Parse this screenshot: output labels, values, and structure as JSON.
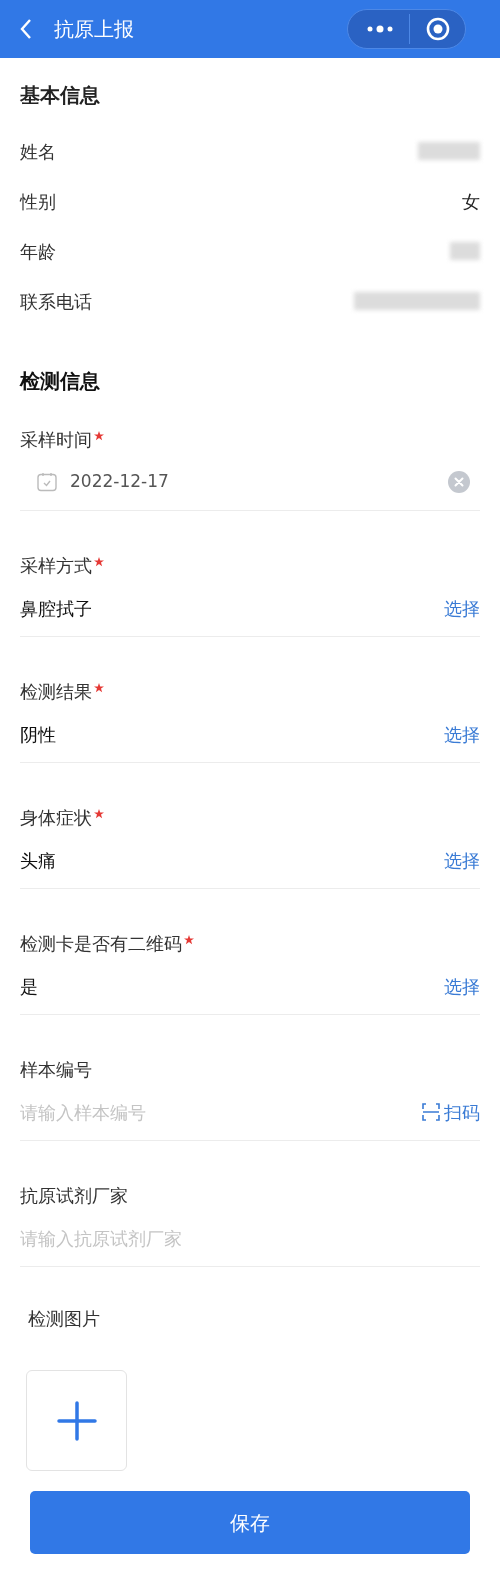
{
  "header": {
    "title": "抗原上报"
  },
  "basic": {
    "title": "基本信息",
    "rows": [
      {
        "label": "姓名",
        "kind": "redacted"
      },
      {
        "label": "性别",
        "kind": "text",
        "value": "女"
      },
      {
        "label": "年龄",
        "kind": "redacted"
      },
      {
        "label": "联系电话",
        "kind": "redacted"
      }
    ]
  },
  "test": {
    "title": "检测信息",
    "fields": [
      {
        "label": "采样时间",
        "required": true,
        "kind": "date",
        "value": "2022-12-17"
      },
      {
        "label": "采样方式",
        "required": true,
        "kind": "select",
        "value": "鼻腔拭子",
        "action": "选择"
      },
      {
        "label": "检测结果",
        "required": true,
        "kind": "select",
        "value": "阴性",
        "action": "选择"
      },
      {
        "label": "身体症状",
        "required": true,
        "kind": "select",
        "value": "头痛",
        "action": "选择"
      },
      {
        "label": "检测卡是否有二维码",
        "required": true,
        "kind": "select",
        "value": "是",
        "action": "选择"
      },
      {
        "label": "样本编号",
        "required": false,
        "kind": "scan",
        "placeholder": "请输入样本编号",
        "action": "扫码"
      },
      {
        "label": "抗原试剂厂家",
        "required": false,
        "kind": "input",
        "placeholder": "请输入抗原试剂厂家"
      }
    ]
  },
  "images": {
    "label": "检测图片"
  },
  "save_button": "保存"
}
